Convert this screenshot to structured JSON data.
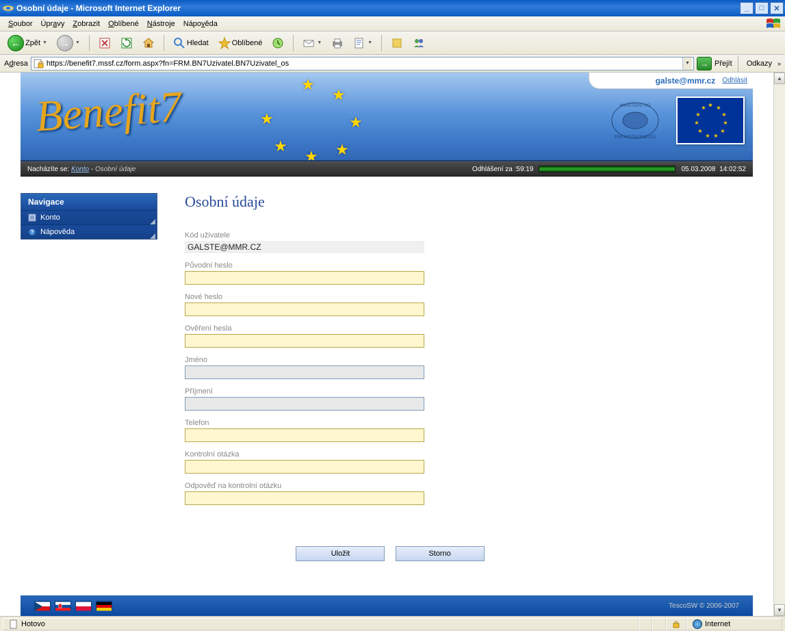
{
  "window": {
    "title": "Osobní údaje - Microsoft Internet Explorer"
  },
  "menubar": {
    "items": [
      "Soubor",
      "Úpravy",
      "Zobrazit",
      "Oblíbené",
      "Nástroje",
      "Nápověda"
    ]
  },
  "toolbar": {
    "back": "Zpět",
    "search": "Hledat",
    "favorites": "Oblíbené"
  },
  "address": {
    "label": "Adresa",
    "url": "https://benefit7.mssf.cz/form.aspx?fn=FRM.BN7Uzivatel.BN7Uzivatel_os",
    "go": "Přejít",
    "links": "Odkazy"
  },
  "banner": {
    "logo": "Benefit7",
    "user_email": "galste@mmr.cz",
    "logout": "Odhlásit"
  },
  "statusline": {
    "prefix": "Nacházíte se:",
    "bc_link": "Konto",
    "bc_current": "Osobní údaje",
    "timer_label": "Odhlášení za :",
    "timer_value": "59:19",
    "date": "05.03.2008",
    "time": "14:02:52"
  },
  "nav": {
    "title": "Navigace",
    "items": [
      "Konto",
      "Nápověda"
    ]
  },
  "form": {
    "title": "Osobní údaje",
    "code_label": "Kód uživatele",
    "code_value": "GALSTE@MMR.CZ",
    "orig_pass_label": "Původní heslo",
    "new_pass_label": "Nové heslo",
    "verify_pass_label": "Ověření hesla",
    "firstname_label": "Jméno",
    "lastname_label": "Příjmení",
    "phone_label": "Telefon",
    "question_label": "Kontrolní otázka",
    "answer_label": "Odpověď na kontrolní otázku",
    "save": "Uložit",
    "cancel": "Storno"
  },
  "footer": {
    "copyright": "TescoSW © 2006-2007"
  },
  "statusbar": {
    "done": "Hotovo",
    "zone": "Internet"
  }
}
